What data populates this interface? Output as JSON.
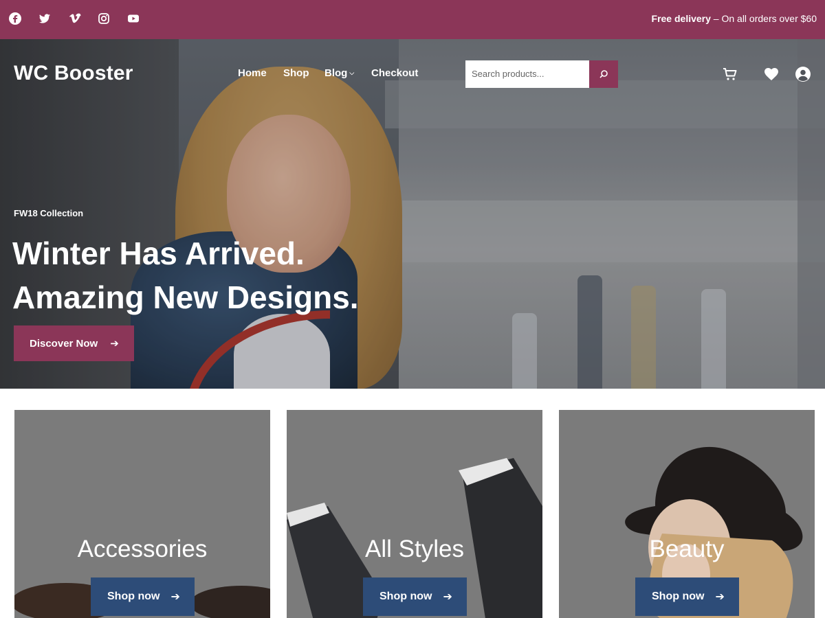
{
  "topbar": {
    "social": [
      {
        "icon": "facebook-icon"
      },
      {
        "icon": "twitter-icon"
      },
      {
        "icon": "vimeo-icon"
      },
      {
        "icon": "instagram-icon"
      },
      {
        "icon": "youtube-icon"
      }
    ],
    "delivery_bold": "Free delivery",
    "delivery_rest": " – On all orders over $60"
  },
  "header": {
    "logo": "WC Booster",
    "nav": [
      "Home",
      "Shop",
      "Blog",
      "Checkout"
    ],
    "search_placeholder": "Search products...",
    "icons": [
      "search-icon",
      "cart-icon",
      "heart-icon",
      "account-icon"
    ]
  },
  "hero": {
    "eyebrow": "FW18 Collection",
    "headline_line1": "Winter Has Arrived.",
    "headline_line2": "Amazing New Designs.",
    "cta": "Discover Now",
    "cta_icon": "arrow-right-icon"
  },
  "categories": [
    {
      "title": "Accessories",
      "button": "Shop now"
    },
    {
      "title": "All Styles",
      "button": "Shop now"
    },
    {
      "title": "Beauty",
      "button": "Shop now"
    }
  ],
  "colors": {
    "brand": "#8b3658",
    "button_blue": "#2d4c78",
    "card_gray": "#7b7b7b"
  }
}
